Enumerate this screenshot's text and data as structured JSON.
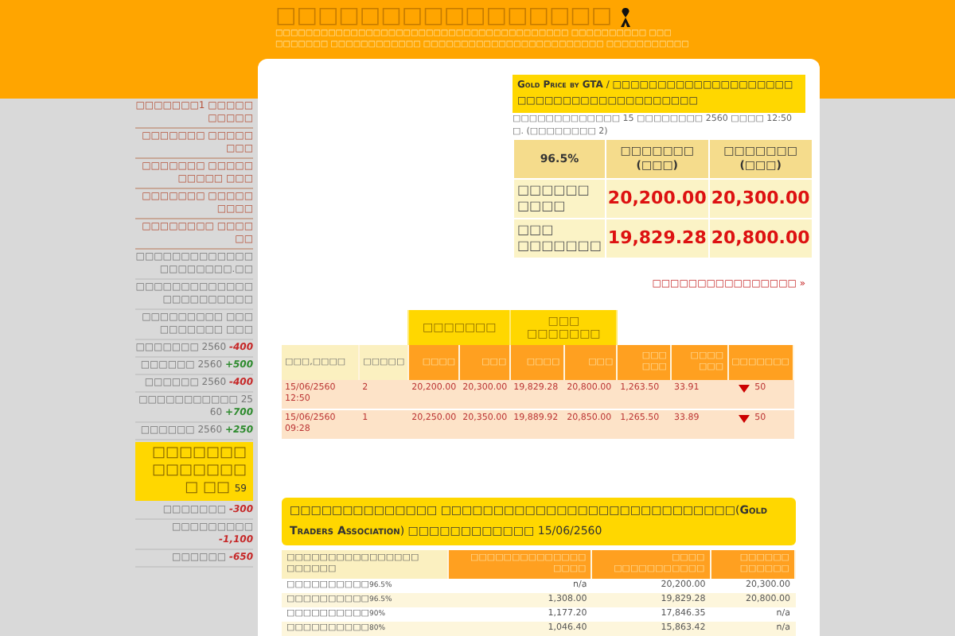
{
  "header": {
    "title": "□□□□□□□□□□□□□□□□",
    "subtitle": [
      "□□□□□□□□□□□□□□□□□□□□□□□□□□□□□□□□□□□□□□□ □□□□□□□□□□ □□□",
      "□□□□□□□ □□□□□□□□□□□□ □□□□□□□□□□□□□□□□□□□□□□□□ □□□□□□□□□□□"
    ]
  },
  "sidebar": {
    "items": [
      {
        "kind": "link",
        "text": "□□□□□□□1 □□□□□□□□□□"
      },
      {
        "kind": "link",
        "text": "□□□□□□□ □□□□□□□□"
      },
      {
        "kind": "link",
        "text": "□□□□□□□ □□□□□□□□□□ □□□"
      },
      {
        "kind": "link",
        "text": "□□□□□□□ □□□□□□□□□"
      },
      {
        "kind": "link",
        "text": "□□□□□□□□ □□□□□□"
      },
      {
        "kind": "plain",
        "text": "□□□□□□□□□□□□□ □□□□□□□□.□□"
      },
      {
        "kind": "plain",
        "text": "□□□□□□□□□□□□□ □□□□□□□□□□"
      },
      {
        "kind": "plain",
        "text": "□□□□□□□□□ □□□□□□□□□□ □□□"
      },
      {
        "kind": "news",
        "text": "□□□□□□□",
        "year": "2560",
        "change": "-400",
        "color": "#c62828"
      },
      {
        "kind": "news",
        "text": "□□□□□□",
        "year": "2560",
        "change": "+500",
        "color": "#2e8b2e"
      },
      {
        "kind": "news",
        "text": "□□□□□□",
        "year": "2560",
        "change": "-400",
        "color": "#c62828"
      },
      {
        "kind": "news",
        "text": "□□□□□□□□□□□",
        "year": "2560",
        "change": "+700",
        "color": "#2e8b2e"
      },
      {
        "kind": "news",
        "text": "□□□□□□",
        "year": "2560",
        "change": "+250",
        "color": "#2e8b2e"
      },
      {
        "kind": "highlight",
        "text": "□□□□□□□ □□□□□□□□ □□",
        "year": "59"
      },
      {
        "kind": "news",
        "text": "□□□□□□□",
        "change": "-300",
        "color": "#c62828"
      },
      {
        "kind": "news",
        "text": "□□□□□□□□□",
        "change": "-1,100",
        "color": "#c62828"
      },
      {
        "kind": "news",
        "text": "□□□□□□",
        "change": "-650",
        "color": "#c62828"
      }
    ]
  },
  "gold_price": {
    "title": "**Gold Price by GTA** / □□□□□□□□□□□□□□□□□□□□□□□□□□□□□□□□□□□□□□□□",
    "updated": "□□□□□□□□□□□□□ 15 □□□□□□□□ 2560 □□□□ 12:50 □. (□□□□□□□□ 2)",
    "columns": [
      "96.5%",
      "□□□□□□□ (□□□)",
      "□□□□□□□ (□□□)"
    ],
    "rows": [
      [
        "□□□□□□ □□□□",
        "20,200.00",
        "20,300.00"
      ],
      [
        "□□□ □□□□□□□",
        "19,829.28",
        "20,800.00"
      ]
    ],
    "more_link": "□□□□□□□□□□□□□□□□ »"
  },
  "history": {
    "groups": [
      "□□□□□□□",
      "□□□ □□□□□□□"
    ],
    "columns": [
      "□□□,□□□□",
      "□□□□□",
      "□□□□",
      "□□□",
      "□□□□",
      "□□□",
      "□□□ □□□",
      "□□□□ □□□",
      "□□□□□□□"
    ],
    "rows": [
      {
        "cells": [
          "15/06/2560 12:50",
          "2",
          "20,200.00",
          "20,300.00",
          "19,829.28",
          "20,800.00",
          "1,263.50",
          "33.91"
        ],
        "change": "50"
      },
      {
        "cells": [
          "15/06/2560 09:28",
          "1",
          "20,250.00",
          "20,350.00",
          "19,889.92",
          "20,850.00",
          "1,265.50",
          "33.89"
        ],
        "change": "50"
      }
    ]
  },
  "association": {
    "title": "□□□□□□□□□□□□□□ □□□□□□□□□□□□□□□□□□□□□□□□□□□□(**Gold Traders Association**) □□□□□□□□□□□□ 15/06/2560",
    "columns": [
      "□□□□□□□□□□□□□□□□ □□□□□□",
      "□□□□□□□□□□□□□□ □□□□",
      "□□□□ □□□□□□□□□□□",
      "□□□□□□ □□□□□□"
    ],
    "rows": [
      {
        "name": "□□□□□□□□□□",
        "purity": "96.5%",
        "values": [
          "n/a",
          "20,200.00",
          "20,300.00"
        ]
      },
      {
        "name": "□□□□□□□□□□",
        "purity": "96.5%",
        "values": [
          "1,308.00",
          "19,829.28",
          "20,800.00"
        ]
      },
      {
        "name": "□□□□□□□□□□",
        "purity": "90%",
        "values": [
          "1,177.20",
          "17,846.35",
          "n/a"
        ]
      },
      {
        "name": "□□□□□□□□□□",
        "purity": "80%",
        "values": [
          "1,046.40",
          "15,863.42",
          "n/a"
        ]
      }
    ]
  }
}
